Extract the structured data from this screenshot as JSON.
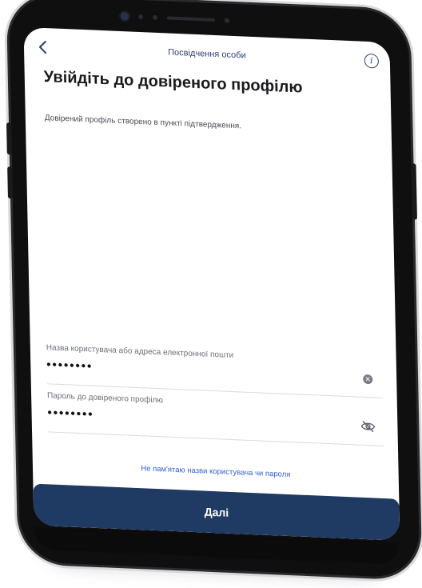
{
  "header": {
    "back_icon": "chevron-left-icon",
    "title": "Посвідчення особи",
    "info_icon": "info-icon"
  },
  "main": {
    "heading": "Увійдіть до довіреного профілю",
    "description": "Довірений профіль створено в пункті підтвердження."
  },
  "form": {
    "username_label": "Назва користувача або адреса електронної пошти",
    "username_value": "••••••••",
    "username_clear_icon": "clear-icon",
    "password_label": "Пароль до довіреного профілю",
    "password_value": "••••••••",
    "password_visibility_icon": "eye-slash-icon"
  },
  "actions": {
    "forgot_link": "Не пам'ятаю назви користувача чи пароля",
    "next_label": "Далі"
  },
  "colors": {
    "accent": "#1f3a63",
    "link": "#2f5ed4"
  }
}
